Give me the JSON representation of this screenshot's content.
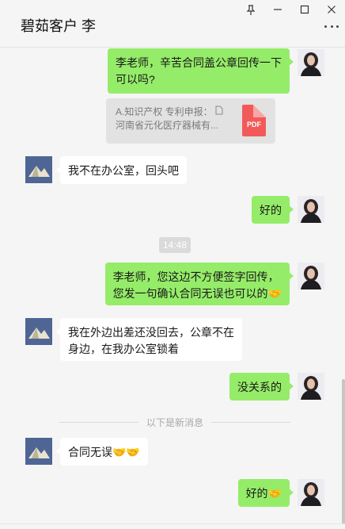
{
  "header": {
    "title": "碧茹客户 李"
  },
  "messages": {
    "m1": {
      "line1": "李老师，辛苦合同盖公章回传一下",
      "line2": "可以吗?"
    },
    "file": {
      "name": "A.知识产权 专利申报：",
      "subtitle": "河南省元化医疗器械有...",
      "badge": "PDF"
    },
    "m2": "我不在办公室，回头吧",
    "m3": "好的",
    "time": "14:48",
    "m4": {
      "line1": "李老师，您这边不方便签字回传，",
      "line2": "您发一句确认合同无误也可以的🤝"
    },
    "m5": {
      "line1": "我在外边出差还没回去，公章不在",
      "line2": "身边，在我办公室锁着"
    },
    "m6": "没关系的",
    "divider": "以下是新消息",
    "m7": "合同无误🤝🤝",
    "m8": "好的🤝"
  },
  "colors": {
    "me_bubble": "#95ec69",
    "other_bubble": "#ffffff",
    "background": "#f5f5f5"
  },
  "icons": {
    "pin": "pin-icon",
    "minimize": "minimize-icon",
    "maximize": "maximize-icon",
    "close": "close-icon",
    "more": "more-icon",
    "file": "file-icon",
    "pdf": "pdf-icon"
  }
}
